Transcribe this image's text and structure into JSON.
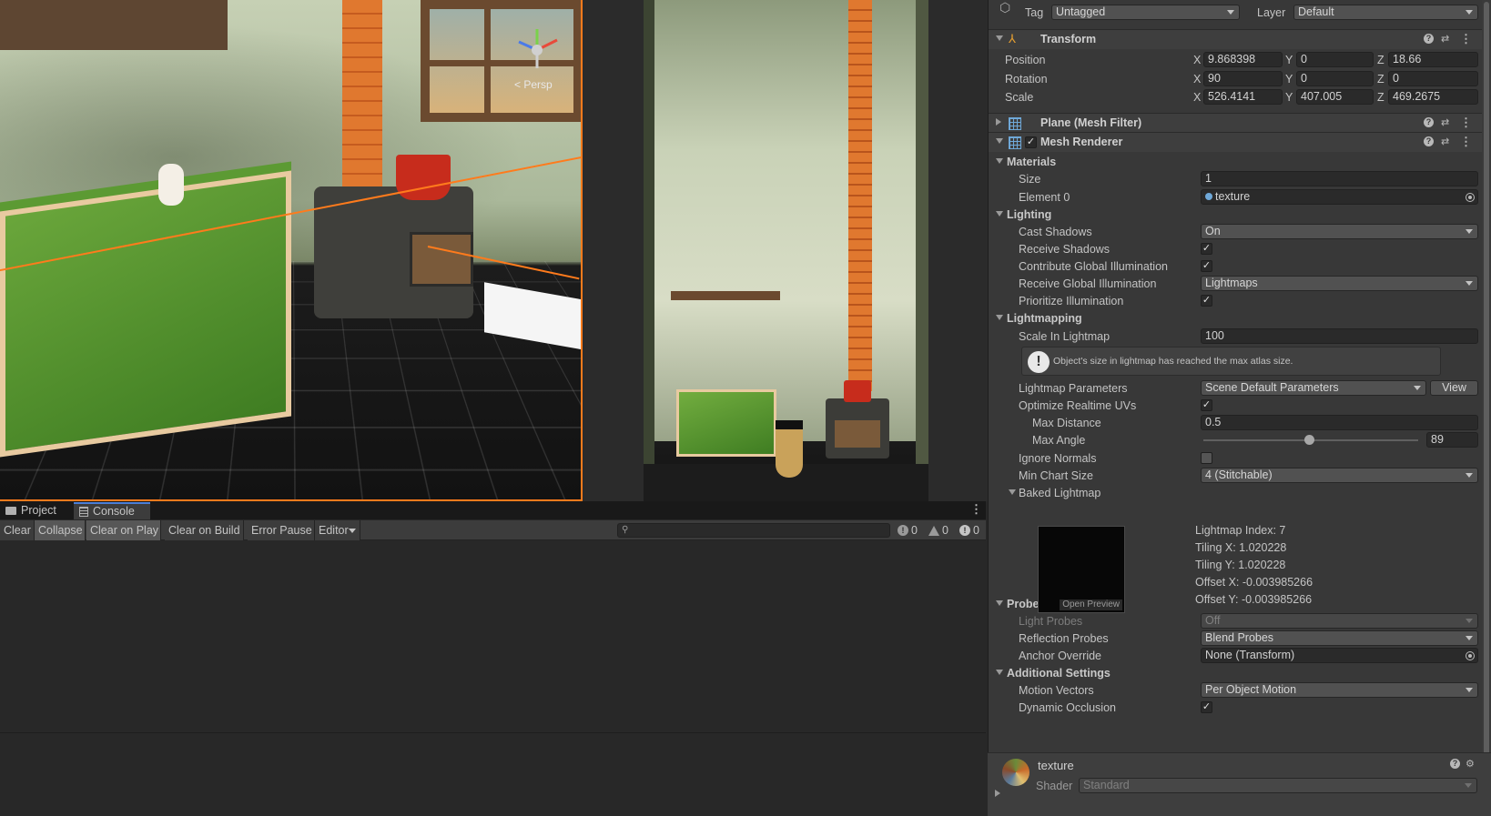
{
  "scene_view": {
    "camera_label": "< Persp"
  },
  "console": {
    "tabs": [
      {
        "label": "Project",
        "icon": "folder-icon"
      },
      {
        "label": "Console",
        "icon": "console-icon"
      }
    ],
    "toolbar": {
      "clear": "Clear",
      "collapse": "Collapse",
      "clear_on_play": "Clear on Play",
      "clear_on_build": "Clear on Build",
      "error_pause": "Error Pause",
      "editor": "Editor"
    },
    "search": {
      "placeholder": ""
    },
    "counts": {
      "info": "0",
      "warnings": "0",
      "errors": "0"
    }
  },
  "inspector": {
    "tag_label": "Tag",
    "tag_value": "Untagged",
    "layer_label": "Layer",
    "layer_value": "Default",
    "transform": {
      "title": "Transform",
      "position_label": "Position",
      "rotation_label": "Rotation",
      "scale_label": "Scale",
      "position": {
        "x": "9.868398",
        "y": "0",
        "z": "18.66"
      },
      "rotation": {
        "x": "90",
        "y": "0",
        "z": "0"
      },
      "scale": {
        "x": "526.4141",
        "y": "407.005",
        "z": "469.2675"
      },
      "axis_x": "X",
      "axis_y": "Y",
      "axis_z": "Z"
    },
    "mesh_filter": {
      "title": "Plane (Mesh Filter)"
    },
    "mesh_renderer": {
      "title": "Mesh Renderer",
      "materials": {
        "title": "Materials",
        "size_label": "Size",
        "size_value": "1",
        "element0_label": "Element 0",
        "element0_value": "texture"
      },
      "lighting": {
        "title": "Lighting",
        "cast_shadows_label": "Cast Shadows",
        "cast_shadows_value": "On",
        "receive_shadows_label": "Receive Shadows",
        "contribute_gi_label": "Contribute Global Illumination",
        "receive_gi_label": "Receive Global Illumination",
        "receive_gi_value": "Lightmaps",
        "prioritize_label": "Prioritize Illumination"
      },
      "lightmapping": {
        "title": "Lightmapping",
        "scale_label": "Scale In Lightmap",
        "scale_value": "100",
        "warning": "Object's size in lightmap has reached the max atlas size.",
        "params_label": "Lightmap Parameters",
        "params_value": "Scene Default Parameters",
        "view_button": "View",
        "optimize_label": "Optimize Realtime UVs",
        "max_distance_label": "Max Distance",
        "max_distance_value": "0.5",
        "max_angle_label": "Max Angle",
        "max_angle_value": "89",
        "max_angle_fraction": 0.494,
        "ignore_normals_label": "Ignore Normals",
        "min_chart_label": "Min Chart Size",
        "min_chart_value": "4 (Stitchable)",
        "baked_title": "Baked Lightmap",
        "open_preview": "Open Preview",
        "index": "Lightmap Index: 7",
        "tiling_x": "Tiling X: 1.020228",
        "tiling_y": "Tiling Y: 1.020228",
        "offset_x": "Offset X: -0.003985266",
        "offset_y": "Offset Y: -0.003985266"
      },
      "probes": {
        "title": "Probes",
        "light_probes_label": "Light Probes",
        "light_probes_value": "Off",
        "reflection_label": "Reflection Probes",
        "reflection_value": "Blend Probes",
        "anchor_label": "Anchor Override",
        "anchor_value": "None (Transform)"
      },
      "additional": {
        "title": "Additional Settings",
        "motion_label": "Motion Vectors",
        "motion_value": "Per Object Motion",
        "dynamic_label": "Dynamic Occlusion"
      }
    },
    "material": {
      "name": "texture",
      "shader_label": "Shader",
      "shader_value": "Standard"
    }
  },
  "colors": {
    "selection_orange": "#ff7b1c",
    "active_tab_blue": "#4c7fd8",
    "panel_bg": "#383838"
  }
}
